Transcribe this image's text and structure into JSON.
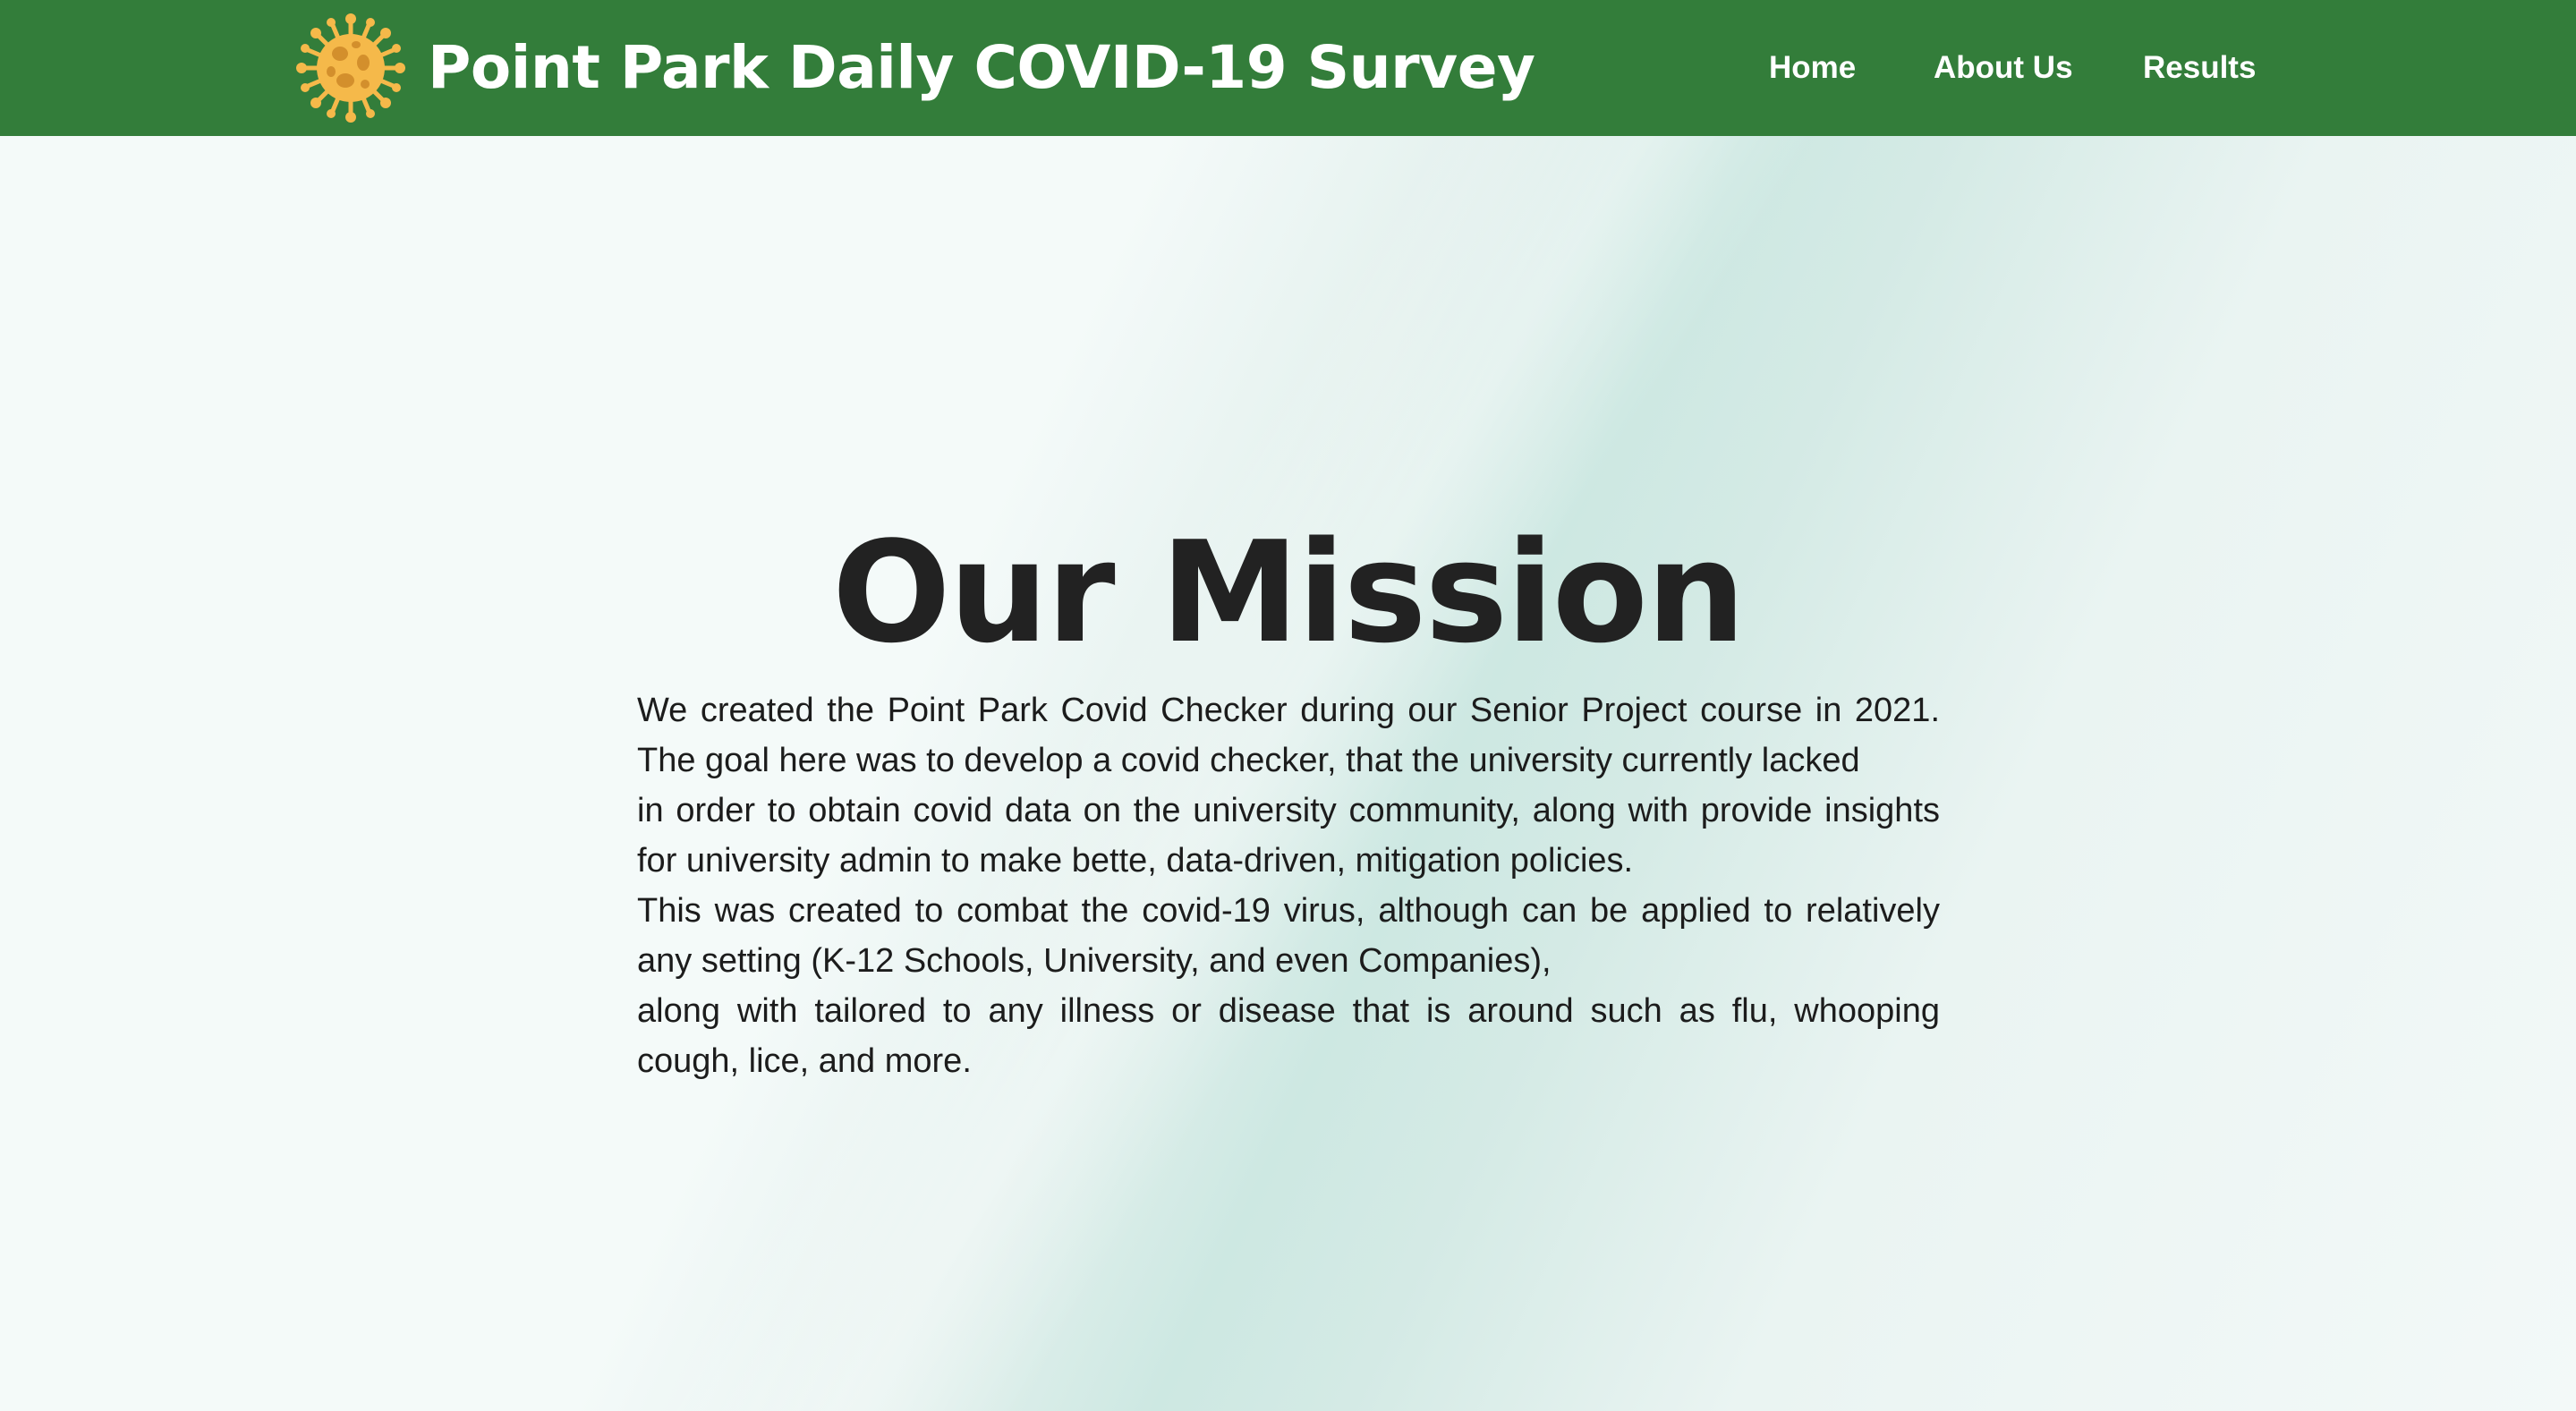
{
  "header": {
    "logo_icon": "virus-icon",
    "title": "Point Park Daily COVID-19 Survey",
    "nav": {
      "home": "Home",
      "about": "About Us",
      "results": "Results"
    },
    "background_color": "#337d3a"
  },
  "main": {
    "mission_title": "Our Mission",
    "paragraphs": [
      "We created the Point Park Covid Checker during our Senior Project course in 2021. The goal here was to develop a covid checker, that the university currently lacked",
      "in order to obtain covid data on the university community, along with provide insights for university admin to make bette, data-driven, mitigation policies.",
      "This was created to combat the covid-19 virus, although can be applied to relatively any setting (K-12 Schools, University, and even Companies),",
      "along with tailored to any illness or disease that is around such as flu, whooping cough, lice, and more."
    ]
  },
  "colors": {
    "accent": "#337d3a",
    "virus_fill": "#f5b94a",
    "virus_spots": "#d38f2c",
    "text": "#1c1c1c"
  }
}
